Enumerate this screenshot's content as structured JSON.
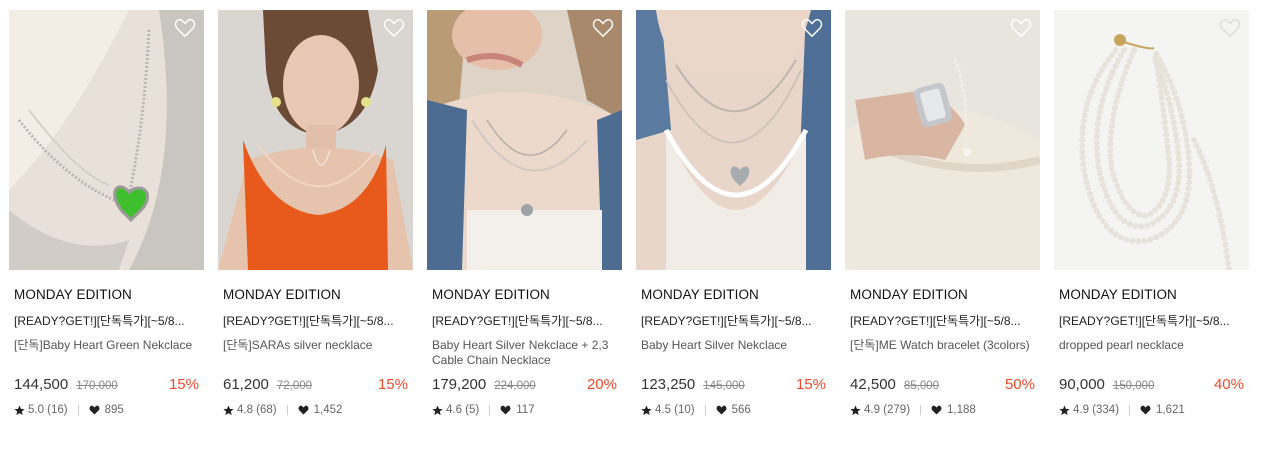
{
  "products": [
    {
      "brand": "MONDAY EDITION",
      "title": "[READY?GET!][단독특가][~5/8...",
      "desc": "[단독]Baby Heart Green Nekclace",
      "price": "144,500",
      "orig": "170,000",
      "discount": "15%",
      "rating": "5.0 (16)",
      "likes": "895"
    },
    {
      "brand": "MONDAY EDITION",
      "title": "[READY?GET!][단독특가][~5/8...",
      "desc": "[단독]SARAs silver necklace",
      "price": "61,200",
      "orig": "72,000",
      "discount": "15%",
      "rating": "4.8 (68)",
      "likes": "1,452"
    },
    {
      "brand": "MONDAY EDITION",
      "title": "[READY?GET!][단독특가][~5/8...",
      "desc": "Baby Heart Silver Nekclace + 2,3 Cable Chain Necklace",
      "price": "179,200",
      "orig": "224,000",
      "discount": "20%",
      "rating": "4.6 (5)",
      "likes": "117"
    },
    {
      "brand": "MONDAY EDITION",
      "title": "[READY?GET!][단독특가][~5/8...",
      "desc": "Baby Heart Silver Nekclace",
      "price": "123,250",
      "orig": "145,000",
      "discount": "15%",
      "rating": "4.5 (10)",
      "likes": "566"
    },
    {
      "brand": "MONDAY EDITION",
      "title": "[READY?GET!][단독특가][~5/8...",
      "desc": "[단독]ME Watch bracelet (3colors)",
      "price": "42,500",
      "orig": "85,000",
      "discount": "50%",
      "rating": "4.9 (279)",
      "likes": "1,188"
    },
    {
      "brand": "MONDAY EDITION",
      "title": "[READY?GET!][단독특가][~5/8...",
      "desc": "dropped pearl necklace",
      "price": "90,000",
      "orig": "150,000",
      "discount": "40%",
      "rating": "4.9 (334)",
      "likes": "1,621"
    }
  ],
  "colors": {
    "discount": "#f04a2a",
    "accent_text": "#111111"
  },
  "icons": {
    "wishlist": "heart-outline-icon",
    "rating": "star-icon",
    "likes": "heart-filled-icon"
  }
}
